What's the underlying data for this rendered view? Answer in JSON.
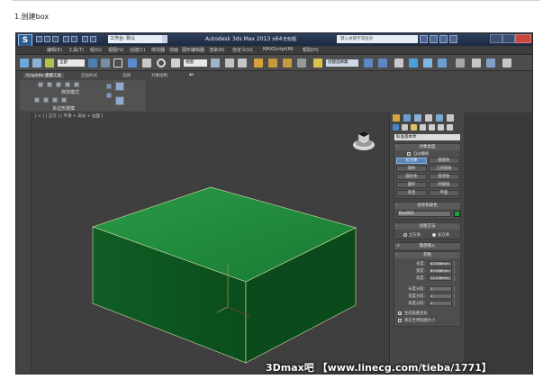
{
  "article": {
    "step_title": "1.创建box"
  },
  "app": {
    "logo_glyph": "S",
    "workspace_label": "工作台: 默认",
    "window_title": "Autodesk 3ds Max  2013 x64",
    "window_title_file": "无标题",
    "search_placeholder": "键入关键字或短语",
    "menu": [
      "编辑(E)",
      "工具(T)",
      "组(G)",
      "视图(V)",
      "创建(C)",
      "修改器",
      "动画",
      "图形编辑器",
      "渲染(R)",
      "自定义(U)",
      "MAXScript(M)",
      "帮助(H)"
    ],
    "toolbar": {
      "selection_filter": "全部",
      "reference_coord": "视图",
      "named_selection": "创建选择集"
    },
    "ribbon": {
      "tabs": [
        "Graphite 建模工具",
        "自由形式",
        "选择",
        "对象绘制"
      ],
      "panel_label": "多边形建模",
      "mode_label": "修改模式"
    },
    "viewport": {
      "label": "[ + ] [ 正交 ] [ 平滑 + 高光 + 边面 ]"
    },
    "command_panel": {
      "category": "标准基本体",
      "object_type": {
        "title": "对象类型",
        "autogrid": "自动栅格",
        "buttons": [
          "长方体",
          "圆锥体",
          "球体",
          "几何球体",
          "圆柱体",
          "管状体",
          "圆环",
          "四棱锥",
          "茶壶",
          "平面"
        ]
      },
      "name_color": {
        "title": "名称和颜色",
        "name": "Box001"
      },
      "creation_method": {
        "title": "创建方法",
        "options": [
          "立方体",
          "长方体"
        ]
      },
      "keyboard_entry": {
        "title": "键盘输入"
      },
      "parameters": {
        "title": "参数",
        "length_label": "长度:",
        "length": "83.968mm",
        "width_label": "宽度:",
        "width": "83.968mm",
        "height_label": "高度:",
        "height": "24.296mm",
        "length_segs_label": "长度分段:",
        "length_segs": "1",
        "width_segs_label": "宽度分段:",
        "width_segs": "1",
        "height_segs_label": "高度分段:",
        "height_segs": "1",
        "gen_uv": "生成贴图坐标",
        "real_world": "真实世界贴图大小"
      }
    }
  },
  "watermark": "3Dmax吧  【www.linecg.com/tieba/1771】",
  "colors": {
    "box_top": "#1e8a3a",
    "box_front": "#0e5a22",
    "box_side": "#0a4a1a",
    "selection_active": "#5b86b9"
  }
}
